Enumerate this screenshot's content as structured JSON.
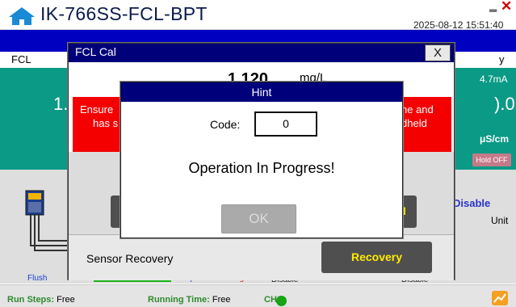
{
  "header": {
    "title": "IK-766SS-FCL-BPT",
    "datetime": "2025-08-12 15:51:40",
    "minimize_glyph": "▂",
    "close_glyph": "✕",
    "home_icon": "home-icon"
  },
  "channels": {
    "left_name": "FCL",
    "right_name_partial": "y",
    "left_reading_partial": "1.",
    "right_reading_partial": ").0",
    "right_ma": "4.7mA",
    "right_unit": "μS/cm",
    "hold_label": "Hold OFF",
    "disable_label": "Disable",
    "unit_label": "Unit"
  },
  "flow": {
    "flush": "Flush",
    "sample": "Sample",
    "detergent": "Detergent",
    "disable_1": "Disable",
    "disable_2": "Disable",
    "flush_color": "#1a3fd6",
    "detergent_color": "#e02020",
    "bar_color": "#1ab51a"
  },
  "status": {
    "run_steps_label": "Run Steps:",
    "run_steps_value": "Free",
    "running_time_label": "Running Time:",
    "running_time_value": "Free",
    "ch1_label": "CH1:",
    "ch1_color": "#14a414",
    "chart_icon": "chart-icon"
  },
  "fcl_dialog": {
    "title": "FCL Cal",
    "close_label": "X",
    "value": "1.120",
    "unit": "mg/L",
    "warning_left_1": "Ensure",
    "warning_left_2": "has s",
    "warning_right_1": "ne and",
    "warning_right_2": "dheld",
    "right_button_label": "al",
    "recovery_label": "Sensor Recovery",
    "recovery_button": "Recovery",
    "warning_color": "#f50000",
    "button_text_color": "#ffea00"
  },
  "hint_dialog": {
    "title": "Hint",
    "code_label": "Code:",
    "code_value": "0",
    "message": "Operation In Progress!",
    "ok_label": "OK"
  },
  "colors": {
    "title_bar": "#00007a",
    "band_blue": "#0000c0",
    "teal": "#0b9a86"
  }
}
